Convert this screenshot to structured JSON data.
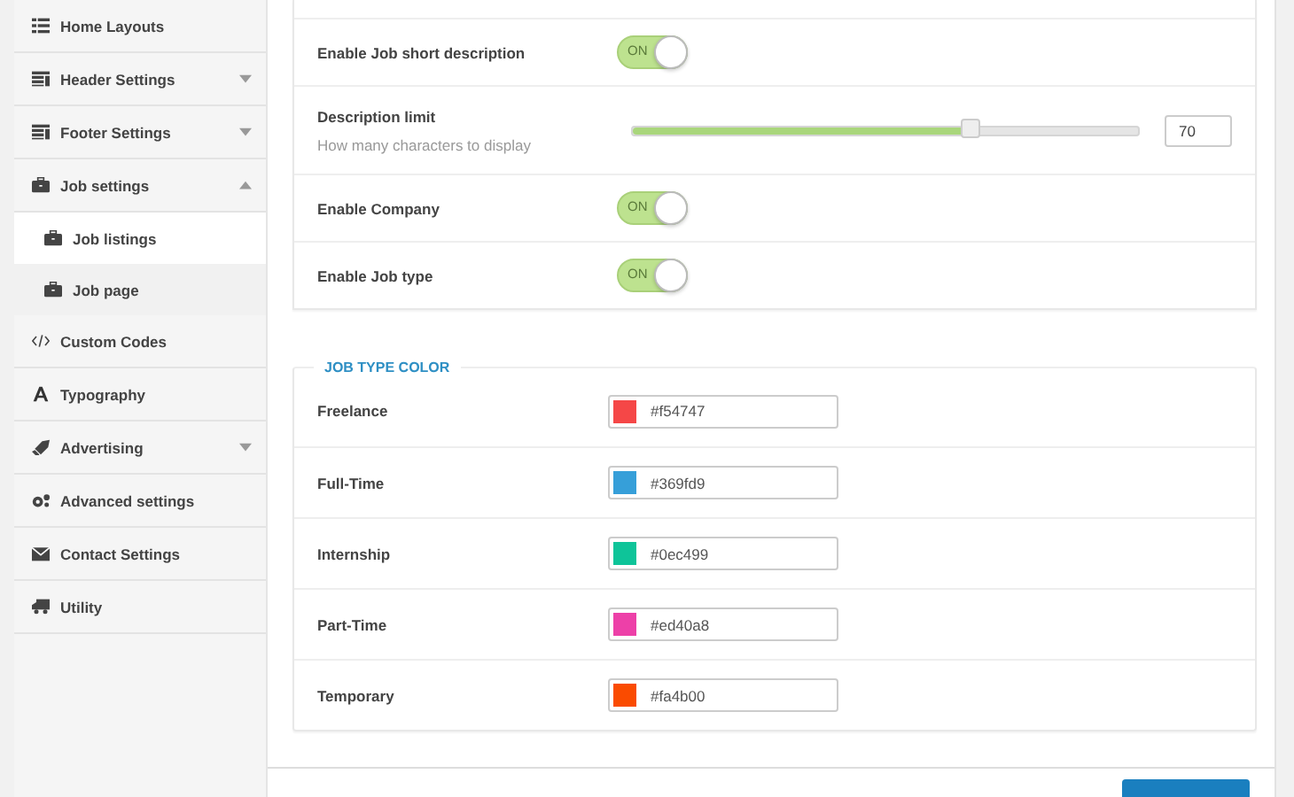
{
  "sidebar": {
    "items": [
      {
        "label": "Home Layouts"
      },
      {
        "label": "Header Settings",
        "expanded": false
      },
      {
        "label": "Footer Settings",
        "expanded": false
      },
      {
        "label": "Job settings",
        "expanded": true,
        "children": [
          {
            "label": "Job listings",
            "selected": true
          },
          {
            "label": "Job page",
            "selected": false
          }
        ]
      },
      {
        "label": "Custom Codes"
      },
      {
        "label": "Typography"
      },
      {
        "label": "Advertising",
        "expanded": false
      },
      {
        "label": "Advanced settings"
      },
      {
        "label": "Contact Settings"
      },
      {
        "label": "Utility"
      }
    ]
  },
  "settings": [
    {
      "kind": "toggle",
      "label": "Enable Job short description",
      "on": true,
      "text": "ON"
    },
    {
      "kind": "slider",
      "label": "Description limit",
      "hint": "How many characters to display",
      "level": 0.67,
      "value": "70"
    },
    {
      "kind": "toggle",
      "label": "Enable Company",
      "on": true,
      "text": "ON"
    },
    {
      "kind": "toggle",
      "label": "Enable Job type",
      "on": true,
      "text": "ON"
    }
  ],
  "job_type_color": {
    "legend": "JOB TYPE COLOR",
    "rows": [
      {
        "label": "Freelance",
        "value": "#f54747",
        "color": "#f54747"
      },
      {
        "label": "Full-Time",
        "value": "#369fd9",
        "color": "#369fd9"
      },
      {
        "label": "Internship",
        "value": "#0ec499",
        "color": "#0ec499"
      },
      {
        "label": "Part-Time",
        "value": "#ed40a8",
        "color": "#ed40a8"
      },
      {
        "label": "Temporary",
        "value": "#fa4b00",
        "color": "#fa4b00"
      }
    ]
  }
}
